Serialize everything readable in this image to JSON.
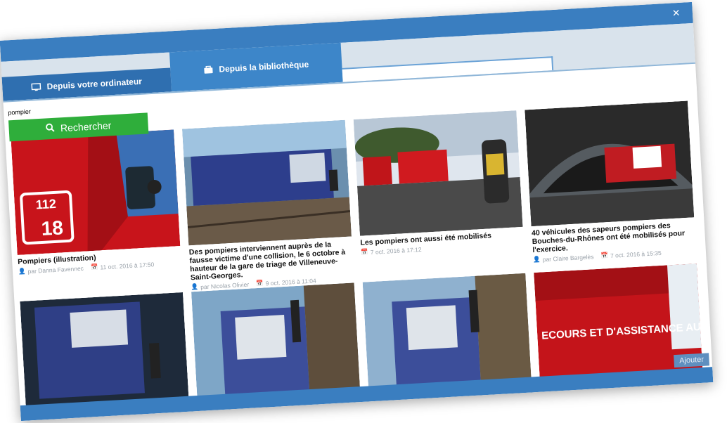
{
  "modal": {
    "close_glyph": "×"
  },
  "tabs": [
    {
      "label": "Depuis votre ordinateur",
      "icon": "monitor-icon"
    },
    {
      "label": "Depuis la bibliothèque",
      "icon": "library-icon"
    }
  ],
  "search": {
    "value": "pompier",
    "button_label": "Rechercher",
    "icon": "search-icon"
  },
  "cards": [
    {
      "title": "Pompiers (illustration)",
      "author": "par Danna Favennec",
      "date": "11 oct. 2016 à 17:50"
    },
    {
      "title": "Des pompiers interviennent auprès de la fausse victime d'une collision, le 6 octobre à hauteur de la gare de triage de Villeneuve-Saint-Georges.",
      "author": "par Nicolas Olivier",
      "date": "9 oct. 2016 à 11:04"
    },
    {
      "title": "Les pompiers ont aussi été mobilisés",
      "author": "",
      "date": "7 oct. 2016 à 17:12"
    },
    {
      "title": "40 véhicules des sapeurs pompiers des Bouches-du-Rhônes ont été mobilisés pour l'exercice.",
      "author": "par Claire Bargelès",
      "date": "7 oct. 2016 à 15:35"
    },
    {
      "title": "",
      "author": "",
      "date": ""
    },
    {
      "title": "",
      "author": "",
      "date": ""
    },
    {
      "title": "",
      "author": "",
      "date": ""
    },
    {
      "title": "",
      "author": "",
      "date": ""
    }
  ],
  "truck_text": {
    "emergency_number_top": "112",
    "emergency_number_bottom": "18",
    "side_text": "ECOURS ET D'ASSISTANCE AUX VICTIMES"
  },
  "footer": {
    "add_label": "Ajouter"
  }
}
